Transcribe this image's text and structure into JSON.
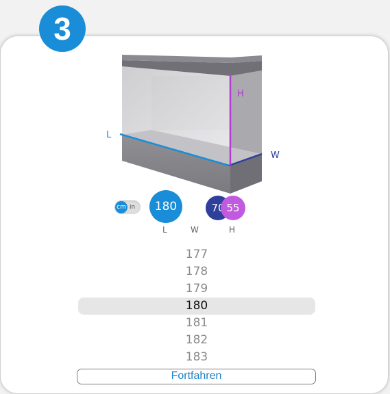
{
  "step": {
    "number": "3"
  },
  "illustration": {
    "length_letter": "L",
    "width_letter": "W",
    "height_letter": "H"
  },
  "unit_toggle": {
    "selected": "cm",
    "other": "in"
  },
  "dimensions": [
    {
      "key": "length",
      "value": "180",
      "label": "L",
      "color": "#1a8dd8"
    },
    {
      "key": "width",
      "value": "70",
      "label": "W",
      "color": "#2e3f9c"
    },
    {
      "key": "height",
      "value": "55",
      "label": "H",
      "color": "#c05be0"
    }
  ],
  "picker": {
    "rows": [
      "177",
      "178",
      "179",
      "180",
      "181",
      "182",
      "183"
    ],
    "selected": "180"
  },
  "continue_button": {
    "label": "Fortfahren"
  }
}
